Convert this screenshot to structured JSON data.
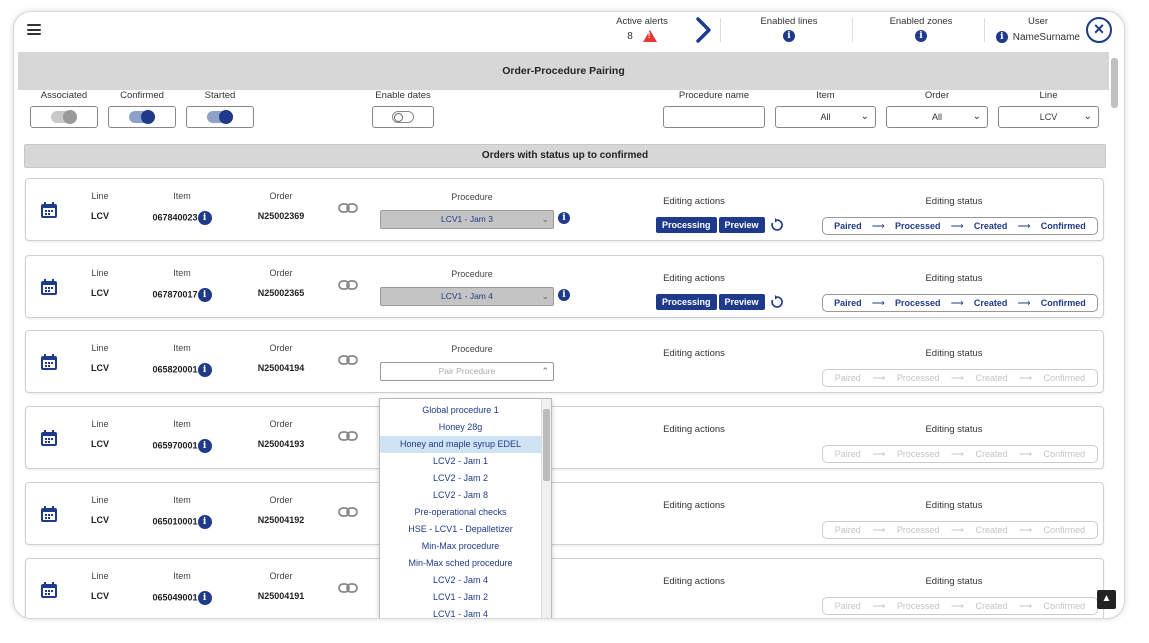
{
  "topbar": {
    "active_alerts_label": "Active alerts",
    "active_alerts_count": "8",
    "enabled_lines_label": "Enabled lines",
    "enabled_zones_label": "Enabled zones",
    "user_label": "User",
    "user_name": "NameSurname"
  },
  "page": {
    "title": "Order-Procedure Pairing",
    "subtitle": "Orders with status up to confirmed"
  },
  "filters": {
    "associated_label": "Associated",
    "confirmed_label": "Confirmed",
    "started_label": "Started",
    "enable_dates_label": "Enable dates",
    "procedure_name_label": "Procedure name",
    "procedure_name_value": "",
    "item_label": "Item",
    "item_value": "All",
    "order_label": "Order",
    "order_value": "All",
    "line_label": "Line",
    "line_value": "LCV"
  },
  "columns": {
    "line": "Line",
    "item": "Item",
    "order": "Order",
    "procedure": "Procedure",
    "editing_actions": "Editing actions",
    "editing_status": "Editing status"
  },
  "actions": {
    "processing": "Processing",
    "preview": "Preview"
  },
  "status_steps": [
    "Paired",
    "Processed",
    "Created",
    "Confirmed"
  ],
  "orders": [
    {
      "line": "LCV",
      "item": "067840023",
      "order": "N25002369",
      "procedure": "LCV1 - Jam 3"
    },
    {
      "line": "LCV",
      "item": "067870017",
      "order": "N25002365",
      "procedure": "LCV1 - Jam 4"
    },
    {
      "line": "LCV",
      "item": "065820001",
      "order": "N25004194",
      "procedure": "Pair Procedure"
    },
    {
      "line": "LCV",
      "item": "065970001",
      "order": "N25004193",
      "procedure": ""
    },
    {
      "line": "LCV",
      "item": "065010001",
      "order": "N25004192",
      "procedure": ""
    },
    {
      "line": "LCV",
      "item": "065049001",
      "order": "N25004191",
      "procedure": ""
    }
  ],
  "dropdown_options": [
    "Global procedure 1",
    "Honey 28g",
    "Honey and maple syrup EDEL",
    "LCV2 - Jam 1",
    "LCV2 - Jam 2",
    "LCV2 - Jam 8",
    "Pre-operational checks",
    "HSE - LCV1 - Depalletizer",
    "Min-Max procedure",
    "Min-Max sched procedure",
    "LCV2 - Jam 4",
    "LCV1 - Jam 2",
    "LCV1 - Jam 4"
  ],
  "colors": {
    "accent": "#1f3a8a",
    "alert": "#e53935",
    "header_bg": "#d7d7d7",
    "highlight": "#cfe3f5"
  }
}
